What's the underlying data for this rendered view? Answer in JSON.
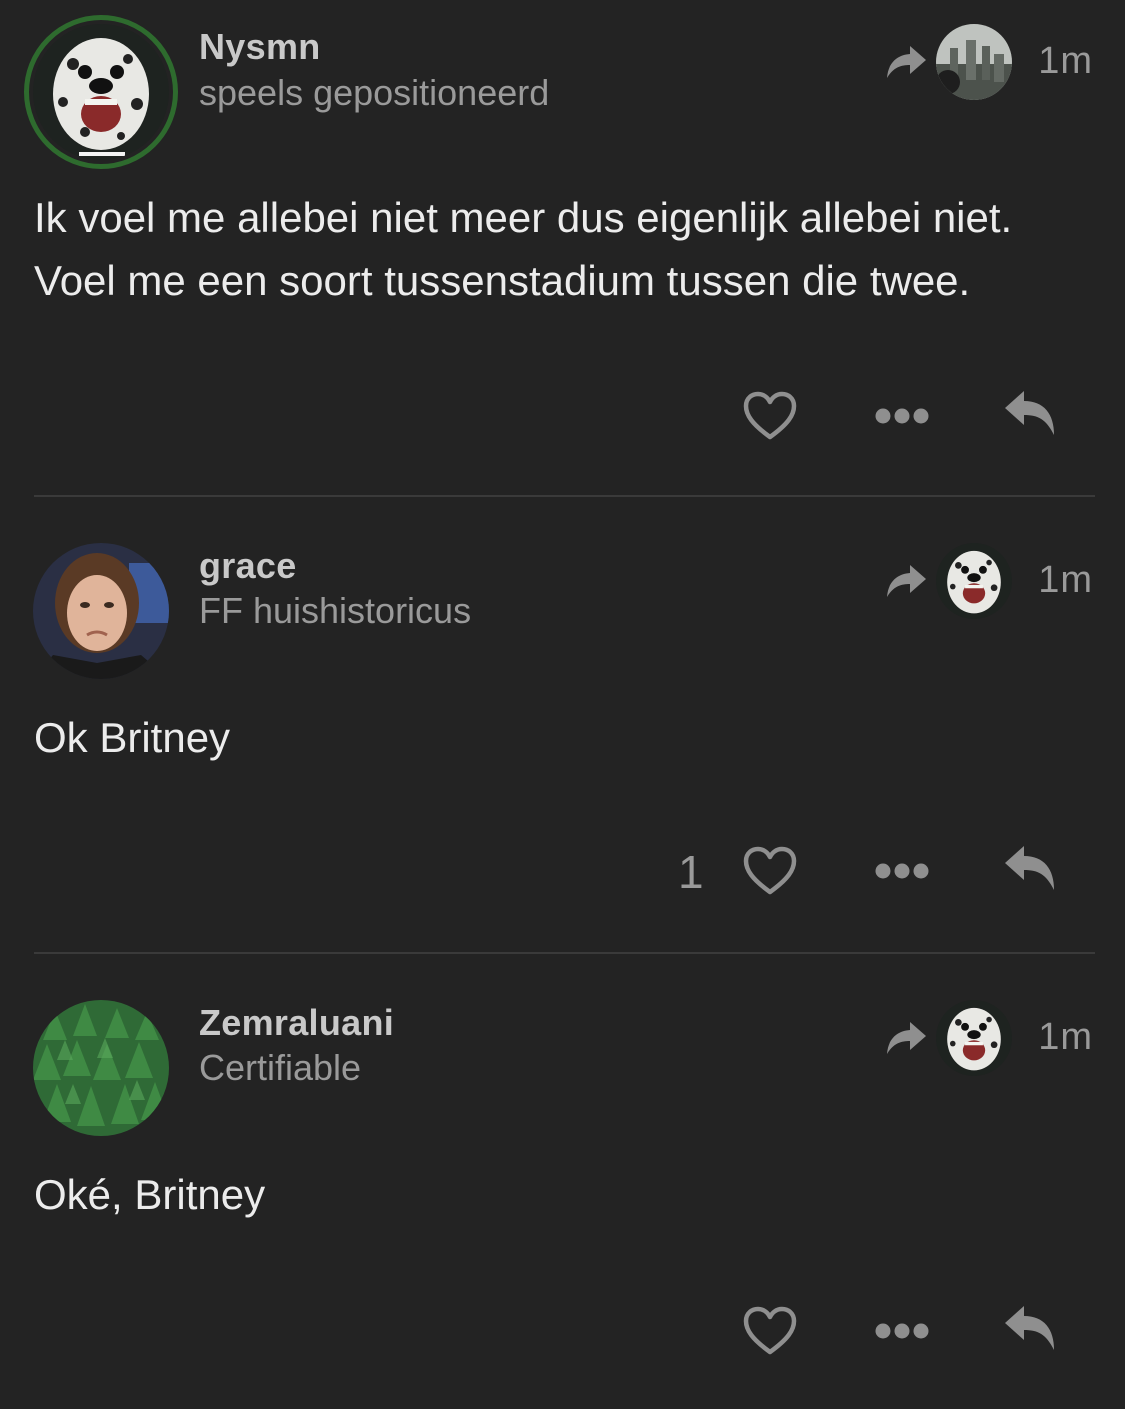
{
  "posts": [
    {
      "username": "Nysmn",
      "title": "speels gepositioneerd",
      "time": "1m",
      "body": "Ik voel me allebei niet meer dus eigenlijk allebei niet. Voel me een soort tussenstadium tussen die twee.",
      "likes": "",
      "avatar_icon": "dalmatian-avatar",
      "reply_to_avatar_icon": "city-avatar"
    },
    {
      "username": "grace",
      "title": "FF huishistoricus",
      "time": "1m",
      "body": "Ok Britney",
      "likes": "1",
      "avatar_icon": "woman-avatar",
      "reply_to_avatar_icon": "dalmatian-avatar"
    },
    {
      "username": "Zemraluani",
      "title": "Certifiable",
      "time": "1m",
      "body": "Oké, Britney",
      "likes": "",
      "avatar_icon": "forest-avatar",
      "reply_to_avatar_icon": "dalmatian-avatar"
    }
  ],
  "colors": {
    "background": "#232323",
    "divider": "#3a3a3a",
    "avatar_ring": "#2e6b2e",
    "icon": "#8f8f8f"
  }
}
